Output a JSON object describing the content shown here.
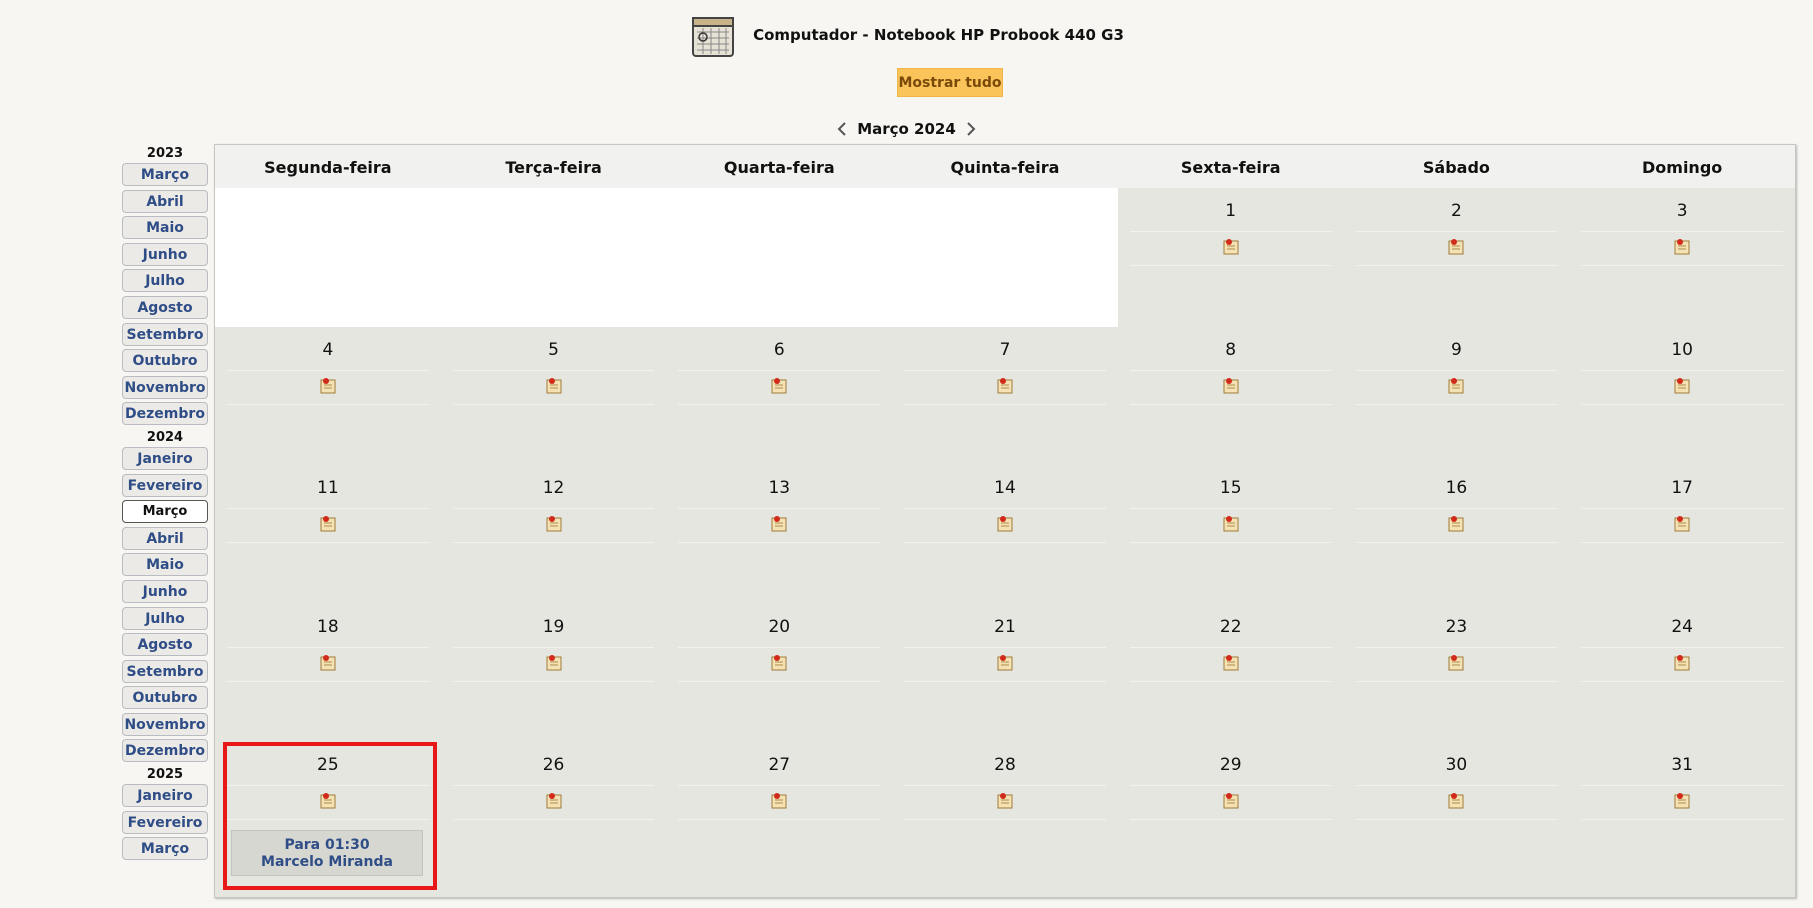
{
  "header": {
    "title": "Computador - Notebook HP Probook 440 G3",
    "icon": "calendar-icon"
  },
  "show_all_label": "Mostrar tudo",
  "month_nav": {
    "label": "Março 2024"
  },
  "sidebar": {
    "groups": [
      {
        "year": "2023",
        "months": [
          "Março",
          "Abril",
          "Maio",
          "Junho",
          "Julho",
          "Agosto",
          "Setembro",
          "Outubro",
          "Novembro",
          "Dezembro"
        ]
      },
      {
        "year": "2024",
        "months": [
          "Janeiro",
          "Fevereiro",
          "Março",
          "Abril",
          "Maio",
          "Junho",
          "Julho",
          "Agosto",
          "Setembro",
          "Outubro",
          "Novembro",
          "Dezembro"
        ],
        "current": "Março"
      },
      {
        "year": "2025",
        "months": [
          "Janeiro",
          "Fevereiro",
          "Março"
        ]
      }
    ]
  },
  "calendar": {
    "weekdays": [
      "Segunda-feira",
      "Terça-feira",
      "Quarta-feira",
      "Quinta-feira",
      "Sexta-feira",
      "Sábado",
      "Domingo"
    ],
    "weeks": [
      [
        "",
        "",
        "",
        "",
        "1",
        "2",
        "3"
      ],
      [
        "4",
        "5",
        "6",
        "7",
        "8",
        "9",
        "10"
      ],
      [
        "11",
        "12",
        "13",
        "14",
        "15",
        "16",
        "17"
      ],
      [
        "18",
        "19",
        "20",
        "21",
        "22",
        "23",
        "24"
      ],
      [
        "25",
        "26",
        "27",
        "28",
        "29",
        "30",
        "31"
      ]
    ],
    "event": {
      "day": "25",
      "line1": "Para 01:30",
      "line2": "Marcelo Miranda"
    }
  },
  "colors": {
    "accent": "#fbc45a",
    "link": "#2f4d86",
    "highlight": "#e81818"
  }
}
